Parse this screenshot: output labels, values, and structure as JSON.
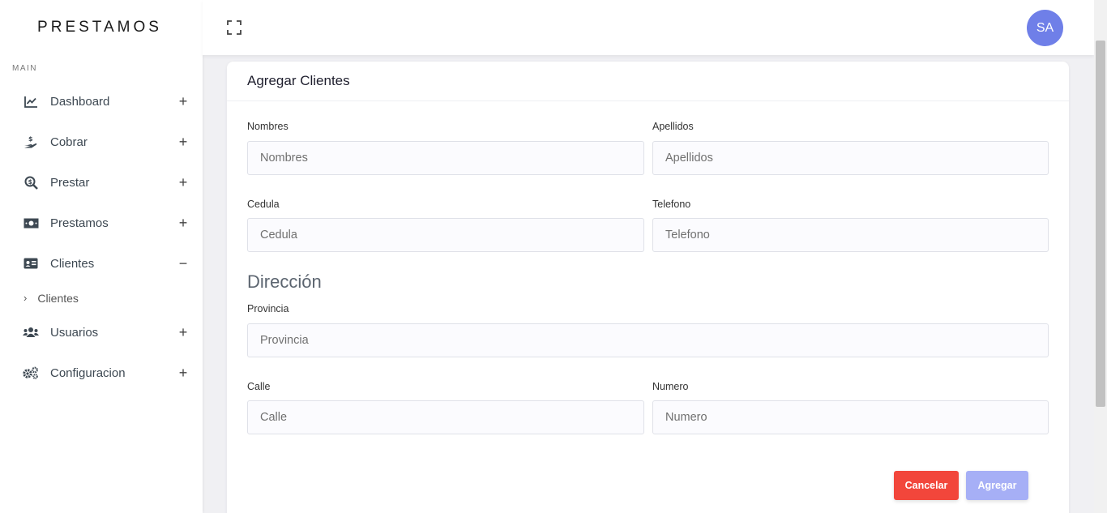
{
  "brand": "PRESTAMOS",
  "sidebar": {
    "section_label": "MAIN",
    "items": [
      {
        "label": "Dashboard",
        "icon": "chart-line-icon",
        "toggle": "+"
      },
      {
        "label": "Cobrar",
        "icon": "hand-money-icon",
        "toggle": "+"
      },
      {
        "label": "Prestar",
        "icon": "search-dollar-icon",
        "toggle": "+"
      },
      {
        "label": "Prestamos",
        "icon": "money-bill-icon",
        "toggle": "+"
      },
      {
        "label": "Clientes",
        "icon": "id-card-icon",
        "toggle": "−"
      },
      {
        "label": "Usuarios",
        "icon": "users-icon",
        "toggle": "+"
      },
      {
        "label": "Configuracion",
        "icon": "cogs-icon",
        "toggle": "+"
      }
    ],
    "sub_items": [
      {
        "label": "Clientes",
        "chevron": "›"
      }
    ]
  },
  "header": {
    "avatar_initials": "SA"
  },
  "form": {
    "title": "Agregar Clientes",
    "fields": {
      "nombres": {
        "label": "Nombres",
        "placeholder": "Nombres",
        "value": ""
      },
      "apellidos": {
        "label": "Apellidos",
        "placeholder": "Apellidos",
        "value": ""
      },
      "cedula": {
        "label": "Cedula",
        "placeholder": "Cedula",
        "value": ""
      },
      "telefono": {
        "label": "Telefono",
        "placeholder": "Telefono",
        "value": ""
      },
      "provincia": {
        "label": "Provincia",
        "placeholder": "Provincia",
        "value": ""
      },
      "calle": {
        "label": "Calle",
        "placeholder": "Calle",
        "value": ""
      },
      "numero": {
        "label": "Numero",
        "placeholder": "Numero",
        "value": ""
      }
    },
    "address_title": "Dirección",
    "cancel_label": "Cancelar",
    "submit_label": "Agregar"
  },
  "colors": {
    "avatar": "#6f7fe8",
    "cancel": "#f2463b",
    "submit": "#a6aff6"
  }
}
